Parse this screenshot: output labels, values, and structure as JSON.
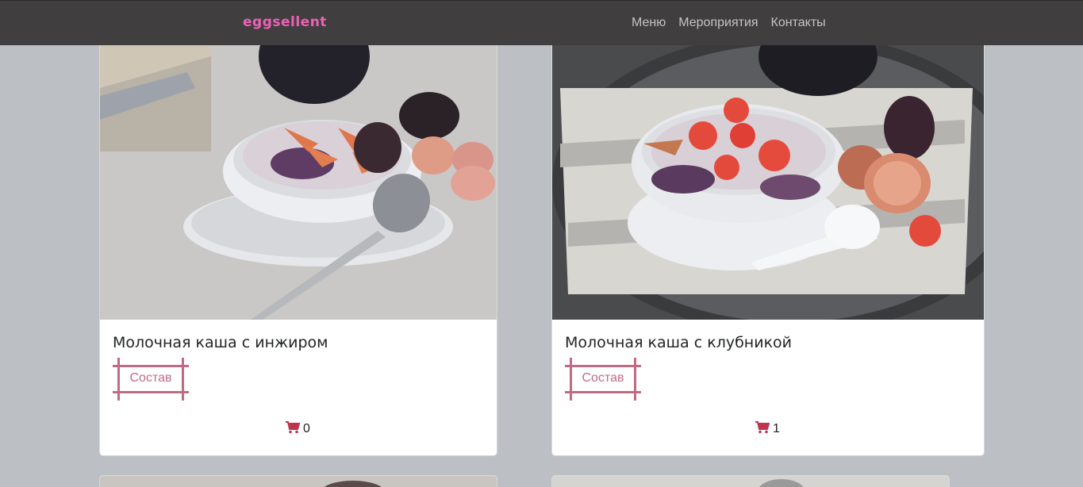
{
  "navbar": {
    "brand": "eggsellent",
    "links": [
      "Меню",
      "Мероприятия",
      "Контакты"
    ],
    "brand_color": "#ec62b4",
    "background": "#403e3f"
  },
  "products": [
    {
      "title": "Молочная каша с инжиром",
      "button_label": "Состав",
      "cart_count": "0",
      "image": "porridge with figs bowl photo"
    },
    {
      "title": "Молочная каша с клубникой",
      "button_label": "Состав",
      "cart_count": "1",
      "image": "porridge with strawberries bowl photo"
    }
  ],
  "icons": {
    "cart": "cart-icon"
  },
  "colors": {
    "accent": "#c06b84",
    "cart_icon": "#c0334f",
    "page_bg": "#bcbfc4"
  }
}
